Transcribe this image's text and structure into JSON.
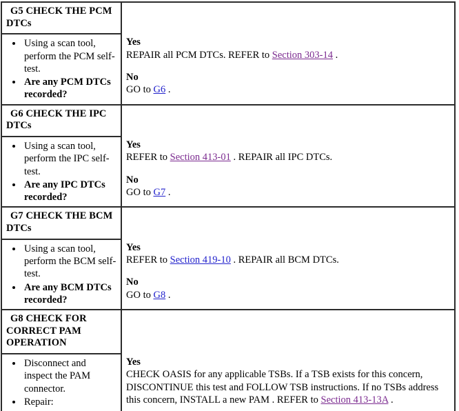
{
  "document": {
    "type": "pinpoint-test-table",
    "column_headers": [
      "test-step-and-actions",
      "results-and-actions"
    ],
    "link_colors": {
      "visited": "#7b2a8f",
      "unvisited": "#2222cc"
    }
  },
  "steps": [
    {
      "id": "G5",
      "title": "G5 CHECK THE PCM DTCs",
      "actions": [
        {
          "text": "Using a scan tool, perform the PCM self-test.",
          "bold": false
        },
        {
          "text": "Are any PCM DTCs recorded?",
          "bold": true
        }
      ],
      "results": [
        {
          "label": "Yes",
          "pre": "REPAIR all PCM DTCs. REFER to ",
          "link": "Section 303-14",
          "link_state": "visited",
          "post": " ."
        },
        {
          "label": "No",
          "pre": "GO to ",
          "link": "G6",
          "link_state": "unvisited",
          "post": " ."
        }
      ]
    },
    {
      "id": "G6",
      "title": "G6 CHECK THE IPC DTCs",
      "actions": [
        {
          "text": "Using a scan tool, perform the IPC self-test.",
          "bold": false
        },
        {
          "text": "Are any IPC DTCs recorded?",
          "bold": true
        }
      ],
      "results": [
        {
          "label": "Yes",
          "pre": "REFER to ",
          "link": "Section 413-01",
          "link_state": "visited",
          "post": " . REPAIR all IPC DTCs."
        },
        {
          "label": "No",
          "pre": "GO to ",
          "link": "G7",
          "link_state": "unvisited",
          "post": " ."
        }
      ]
    },
    {
      "id": "G7",
      "title": "G7 CHECK THE BCM DTCs",
      "actions": [
        {
          "text": "Using a scan tool, perform the BCM self-test.",
          "bold": false
        },
        {
          "text": "Are any BCM DTCs recorded?",
          "bold": true
        }
      ],
      "results": [
        {
          "label": "Yes",
          "pre": "REFER to ",
          "link": "Section 419-10",
          "link_state": "unvisited",
          "post": " . REPAIR all BCM DTCs."
        },
        {
          "label": "No",
          "pre": "GO to ",
          "link": "G8",
          "link_state": "unvisited",
          "post": " ."
        }
      ]
    },
    {
      "id": "G8",
      "title": "G8 CHECK FOR CORRECT PAM OPERATION",
      "actions": [
        {
          "text": "Disconnect and inspect the PAM connector.",
          "bold": false
        },
        {
          "text": "Repair:",
          "bold": false
        }
      ],
      "results": [
        {
          "label": "Yes",
          "pre": "CHECK OASIS for any applicable TSBs. If a TSB exists for this concern, DISCONTINUE this test and FOLLOW TSB instructions. If no TSBs address this concern, INSTALL a new PAM . REFER to ",
          "link": "Section 413-13A",
          "link_state": "visited",
          "post": " ."
        }
      ]
    }
  ]
}
